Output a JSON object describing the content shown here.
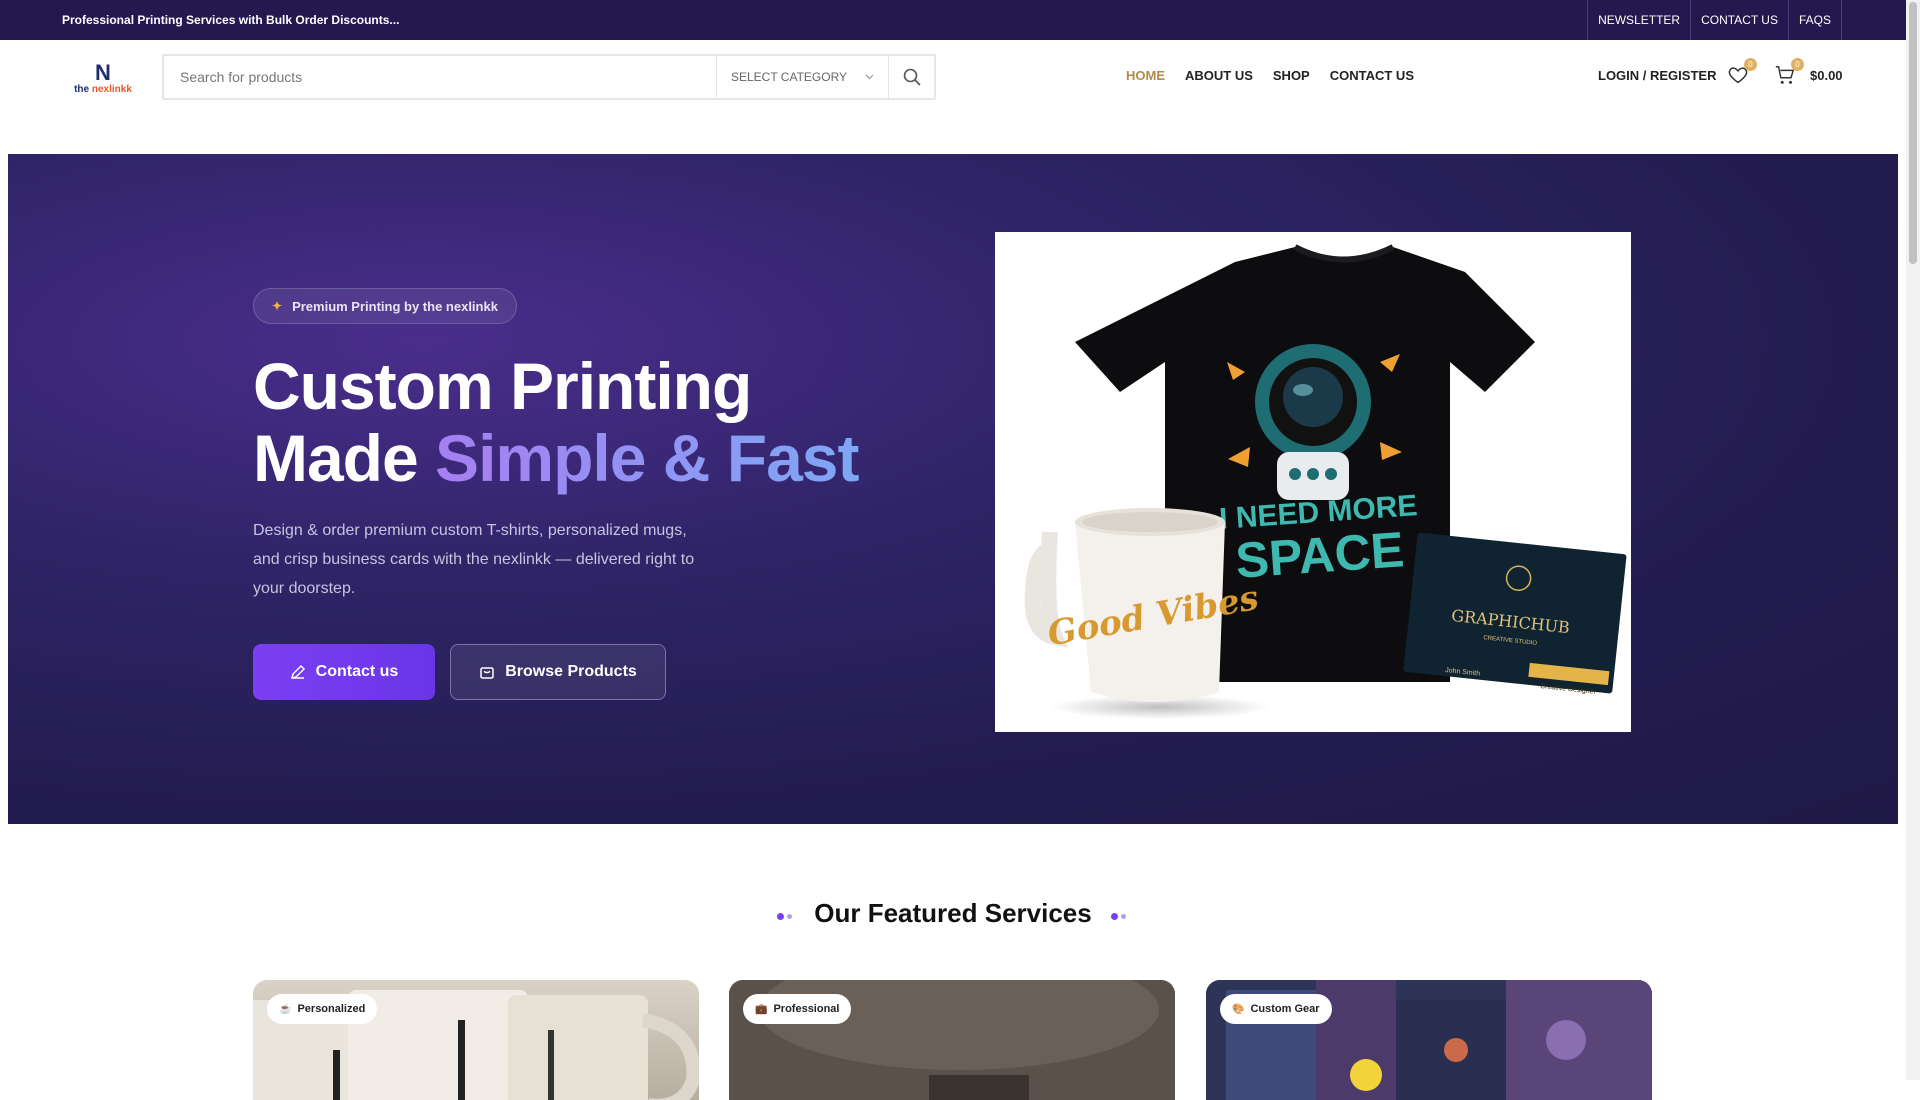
{
  "topbar": {
    "promo": "Professional Printing Services with Bulk Order Discounts...",
    "links": [
      "NEWSLETTER",
      "CONTACT US",
      "FAQS"
    ]
  },
  "header": {
    "logo": {
      "mark": "N",
      "word_prefix": "the ",
      "word_accent": "nexlinkk"
    },
    "search": {
      "placeholder": "Search for products",
      "category": "SELECT CATEGORY"
    },
    "nav": [
      {
        "label": "HOME",
        "active": true
      },
      {
        "label": "ABOUT US",
        "active": false
      },
      {
        "label": "SHOP",
        "active": false
      },
      {
        "label": "CONTACT US",
        "active": false
      }
    ],
    "account": "LOGIN / REGISTER",
    "wishlist_count": "0",
    "cart_count": "0",
    "cart_total": "$0.00"
  },
  "hero": {
    "pill": "Premium Printing by the nexlinkk",
    "title_line1": "Custom Printing",
    "title_line2_prefix": "Made ",
    "title_line2_accent": "Simple & Fast",
    "description": "Design & order premium custom T-shirts, personalized mugs, and crisp business cards with the nexlinkk — delivered right to your doorstep.",
    "cta_primary": "Contact us",
    "cta_secondary": "Browse Products",
    "image": {
      "mug_text": "Good Vibes",
      "shirt_text_1": "I NEED MORE",
      "shirt_text_2": "SPACE",
      "card_title": "GRAPHICHUB",
      "card_subtitle": "CREATIVE STUDIO",
      "card_name": "John Smith",
      "card_role": "Creative Designer"
    }
  },
  "services": {
    "title": "Our Featured Services",
    "cards": [
      {
        "tag": "Personalized",
        "icon": "cup-icon"
      },
      {
        "tag": "Professional",
        "icon": "briefcase-icon"
      },
      {
        "tag": "Custom Gear",
        "icon": "palette-icon"
      }
    ]
  },
  "colors": {
    "topbar": "#24184f",
    "accent": "#7b3ff2",
    "nav_active": "#b28a4a"
  }
}
